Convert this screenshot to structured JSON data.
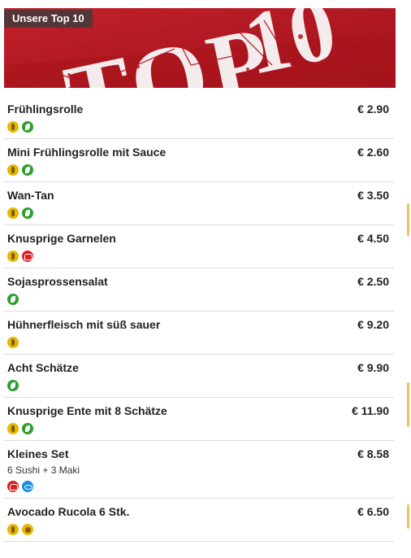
{
  "banner": {
    "tag_label": "Unsere Top 10",
    "stamp_text": "TOP 10"
  },
  "currency": "€",
  "items": [
    {
      "name": "Frühlingsrolle",
      "price": "€ 2.90",
      "description": "",
      "icons": [
        "gluten-icon",
        "vegetarian-icon"
      ]
    },
    {
      "name": "Mini Frühlingsrolle mit Sauce",
      "price": "€ 2.60",
      "description": "",
      "icons": [
        "gluten-icon",
        "vegetarian-icon"
      ]
    },
    {
      "name": "Wan-Tan",
      "price": "€ 3.50",
      "description": "",
      "icons": [
        "gluten-icon",
        "vegetarian-icon"
      ]
    },
    {
      "name": "Knusprige Garnelen",
      "price": "€ 4.50",
      "description": "",
      "icons": [
        "gluten-icon",
        "crustacean-icon"
      ]
    },
    {
      "name": "Sojasprossensalat",
      "price": "€ 2.50",
      "description": "",
      "icons": [
        "vegetarian-icon"
      ]
    },
    {
      "name": "Hühnerfleisch mit süß sauer",
      "price": "€ 9.20",
      "description": "",
      "icons": [
        "gluten-icon"
      ]
    },
    {
      "name": "Acht Schätze",
      "price": "€ 9.90",
      "description": "",
      "icons": [
        "vegetarian-icon"
      ]
    },
    {
      "name": "Knusprige Ente mit 8 Schätze",
      "price": "€ 11.90",
      "description": "",
      "icons": [
        "gluten-icon",
        "vegetarian-icon"
      ]
    },
    {
      "name": "Kleines Set",
      "price": "€ 8.58",
      "description": "6 Sushi + 3 Maki",
      "icons": [
        "crustacean-icon",
        "fish-icon"
      ]
    },
    {
      "name": "Avocado Rucola 6 Stk.",
      "price": "€ 6.50",
      "description": "",
      "icons": [
        "gluten-icon",
        "nut-icon"
      ]
    }
  ],
  "colors": {
    "banner_red": "#b41822",
    "gluten": "#e6b800",
    "vegetarian": "#2e9e2e",
    "crustacean": "#d92020",
    "fish": "#1e8fe0"
  }
}
